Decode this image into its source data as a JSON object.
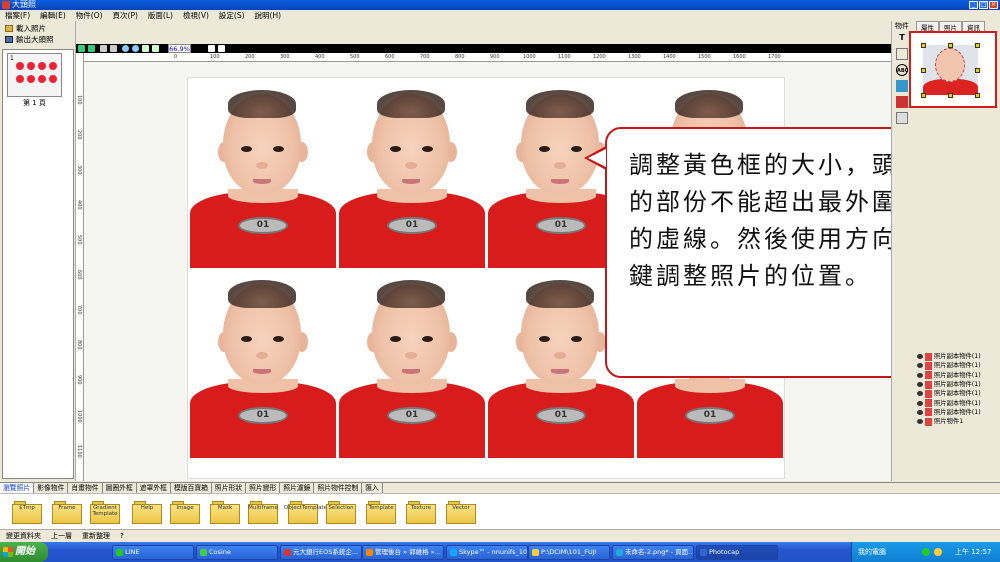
{
  "window": {
    "title": "大頭照"
  },
  "menu": [
    "檔案(F)",
    "編輯(E)",
    "物件(O)",
    "頁次(P)",
    "版面(L)",
    "檢視(V)",
    "設定(S)",
    "說明(H)"
  ],
  "left_panel": {
    "load_photo": "載入照片",
    "export_photo": "輸出大頭照",
    "page_number": "1",
    "page_label": "第 1 頁"
  },
  "toolbar": {
    "zoom": "66.9%"
  },
  "ruler_top": [
    "0",
    "100",
    "200",
    "300",
    "400",
    "500",
    "600",
    "700",
    "800",
    "900",
    "1000",
    "1100",
    "1200",
    "1300",
    "1400",
    "1500",
    "1600",
    "1700"
  ],
  "ruler_left": [
    "100",
    "200",
    "300",
    "400",
    "500",
    "600",
    "700",
    "800",
    "900",
    "1000",
    "1100"
  ],
  "photos": {
    "badge": "01"
  },
  "callout": {
    "text": "調整黃色框的大小，頭的部份不能超出最外圍的虛線。然後使用方向鍵調整照片的位置。"
  },
  "right_panel": {
    "title": "物件",
    "tabs": [
      "屬性",
      "照片",
      "資訊"
    ],
    "icons": [
      "T",
      "ABC"
    ],
    "objects": [
      "照片副本物件(1)",
      "照片副本物件(1)",
      "照片副本物件(1)",
      "照片副本物件(1)",
      "照片副本物件(1)",
      "照片副本物件(1)",
      "照片副本物件(1)",
      "照片物件1"
    ]
  },
  "bottom_tabs": [
    "瀏覽照片",
    "影像物件",
    "肖畫物件",
    "圖圈外框",
    "遮罩外框",
    "模版百寶箱",
    "照片形狀",
    "照片變形",
    "照片濾鏡",
    "照片物件控制",
    "匯入"
  ],
  "folders": [
    "$Tmp",
    "Frame",
    "Gradient Template",
    "Help",
    "Image",
    "Mask",
    "Multiframe",
    "ObjectTemplate",
    "Selection",
    "Template",
    "Texture",
    "Vector"
  ],
  "status_row": {
    "change_folder": "變更資料夾",
    "up": "上一層",
    "reorganize": "重新整理",
    "help": "?"
  },
  "taskbar": {
    "start": "開始",
    "tasks": [
      "LINE",
      "Cosine",
      "元大銀行EOS系統企...",
      "管理後台 » 郭維格 »...",
      "Skype™ - nnunifs_1005",
      "P:\\DCIM\\101_FUJI",
      "未命名-2.png* - 頁面...",
      "Photocap"
    ],
    "tray_label": "我的電腦",
    "clock": "上午 12:57"
  },
  "colors": {
    "accent_red": "#c41818",
    "shirt_red": "#d81c1c",
    "handle_yellow": "#f0d000",
    "taskbar_blue": "#2455cf"
  }
}
